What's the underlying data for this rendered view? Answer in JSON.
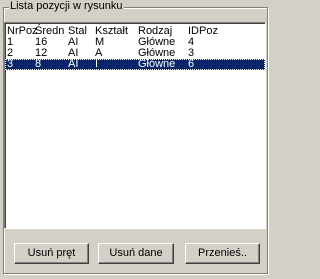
{
  "group": {
    "title": "Lista pozycji w rysunku"
  },
  "list": {
    "columns": [
      "NrPoz",
      "Średn",
      "Stal",
      "Kształt",
      "Rodzaj",
      "IDPoz"
    ],
    "rows": [
      [
        "1",
        "16",
        "AI",
        "M",
        "Główne",
        "4"
      ],
      [
        "2",
        "12",
        "AI",
        "A",
        "Główne",
        "3"
      ],
      [
        "3",
        "8",
        "AI",
        "I",
        "Główne",
        "6"
      ]
    ],
    "selected_row_index": 2
  },
  "buttons": {
    "remove_bar": "Usuń pręt",
    "remove_data": "Usuń dane",
    "move": "Przenieś.."
  },
  "colors": {
    "face": "#d4d0c8",
    "selection": "#0a246a",
    "list_background": "#ffffff"
  }
}
